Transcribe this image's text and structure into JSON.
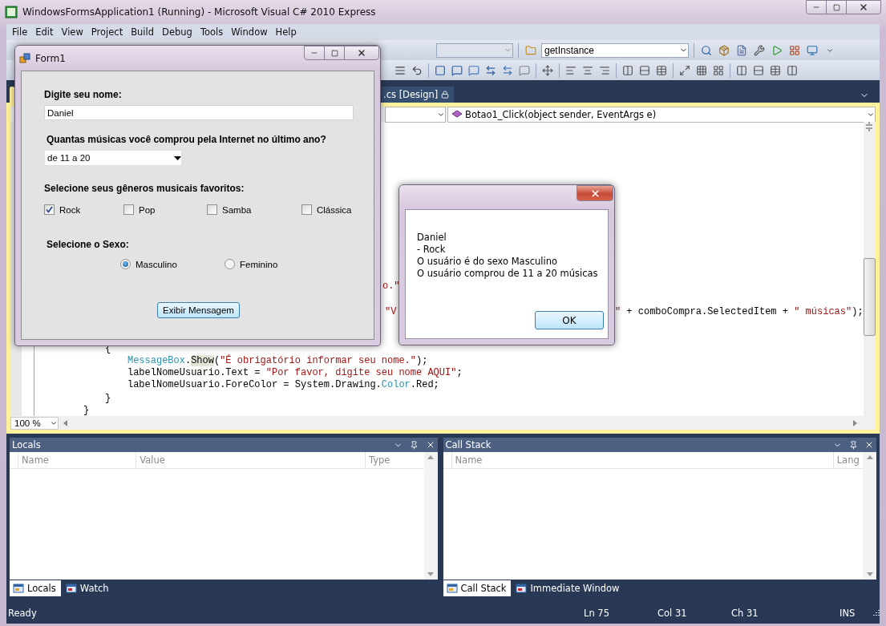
{
  "window": {
    "title": "WindowsFormsApplication1 (Running) - Microsoft Visual C# 2010 Express"
  },
  "menu": [
    "File",
    "Edit",
    "View",
    "Project",
    "Build",
    "Debug",
    "Tools",
    "Window",
    "Help"
  ],
  "toolbar": {
    "member_combo": "getInstance"
  },
  "document_tab": {
    "label": ".cs [Design]"
  },
  "navigation": {
    "member": "Botao1_Click(object sender, EventArgs e)"
  },
  "code_lines": [
    {
      "segments": [
        [
          {
            "kind": "string",
            "text": "o.\""
          }
        ]
      ]
    },
    {
      "segments": [
        [
          {
            "kind": "string",
            "text": "\"V"
          }
        ],
        [
          {
            "kind": "string",
            "text": "\""
          },
          {
            "kind": "plain",
            "text": " + comboCompra.SelectedItem + "
          },
          {
            "kind": "string",
            "text": "\" músicas\""
          },
          {
            "kind": "plain",
            "text": ");"
          }
        ]
      ]
    },
    {
      "segments": [
        [
          {
            "kind": "plain",
            "text": "{"
          }
        ]
      ]
    },
    {
      "segments": [
        [
          {
            "kind": "type",
            "text": "MessageBox"
          },
          {
            "kind": "plain",
            "text": "."
          },
          {
            "kind": "highlight",
            "text": "Show"
          },
          {
            "kind": "plain",
            "text": "("
          },
          {
            "kind": "string",
            "text": "\"É obrigatório informar seu nome.\""
          },
          {
            "kind": "plain",
            "text": ");"
          }
        ]
      ]
    },
    {
      "segments": [
        [
          {
            "kind": "plain",
            "text": "labelNomeUsuario.Text = "
          },
          {
            "kind": "string",
            "text": "\"Por favor, digite seu nome AQUI\""
          },
          {
            "kind": "plain",
            "text": ";"
          }
        ]
      ]
    },
    {
      "segments": [
        [
          {
            "kind": "plain",
            "text": "labelNomeUsuario.ForeColor = System.Drawing."
          },
          {
            "kind": "type",
            "text": "Color"
          },
          {
            "kind": "plain",
            "text": ".Red;"
          }
        ]
      ]
    },
    {
      "segments": [
        [
          {
            "kind": "plain",
            "text": "}"
          }
        ]
      ]
    },
    {
      "segments": [
        [
          {
            "kind": "plain",
            "text": "}"
          }
        ]
      ]
    }
  ],
  "zoom": "100 %",
  "panels": [
    {
      "title": "Locals",
      "columns": [
        "Name",
        "Value",
        "Type"
      ],
      "tabs": [
        {
          "label": "Locals",
          "selected": true
        },
        {
          "label": "Watch",
          "selected": false
        }
      ]
    },
    {
      "title": "Call Stack",
      "columns": [
        "Name",
        "Lang"
      ],
      "tabs": [
        {
          "label": "Call Stack",
          "selected": true
        },
        {
          "label": "Immediate Window",
          "selected": false
        }
      ]
    }
  ],
  "status_bar": {
    "state": "Ready",
    "line": "Ln 75",
    "column": "Col 31",
    "char": "Ch 31",
    "mode": "INS"
  },
  "form1": {
    "title": "Form1",
    "name_label": "Digite seu nome:",
    "name_value": "Daniel",
    "purchase_label": "Quantas músicas você comprou pela Internet no último ano?",
    "purchase_value": "de 11 a 20",
    "genres_label": "Selecione seus gêneros musicais favoritos:",
    "genres": [
      {
        "label": "Rock",
        "checked": true
      },
      {
        "label": "Pop",
        "checked": false
      },
      {
        "label": "Samba",
        "checked": false
      },
      {
        "label": "Clássica",
        "checked": false
      }
    ],
    "sex_label": "Selecione o Sexo:",
    "sexes": [
      {
        "label": "Masculino",
        "selected": true
      },
      {
        "label": "Feminino",
        "selected": false
      }
    ],
    "button": "Exibir Mensagem"
  },
  "message_box": {
    "lines": [
      "Daniel",
      "- Rock",
      "O usuário é do sexo Masculino",
      "O usuário comprou de 11 a 20 músicas"
    ],
    "button": "OK"
  }
}
